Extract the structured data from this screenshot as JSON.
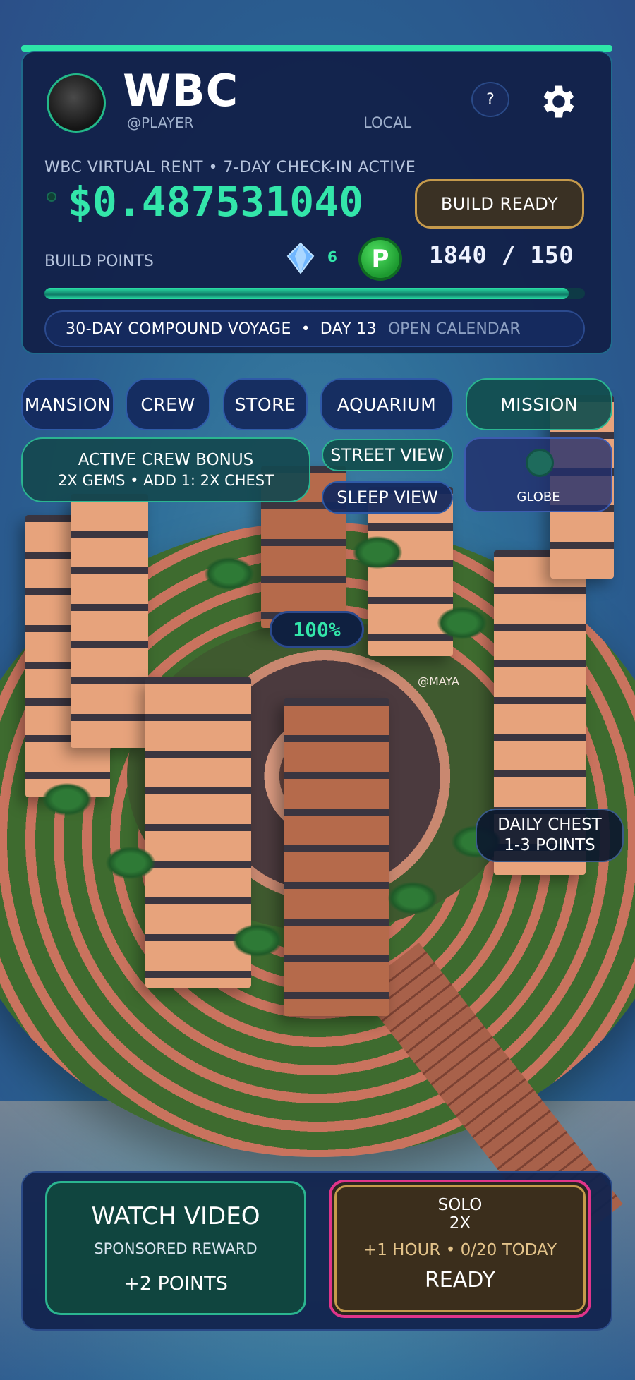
{
  "header": {
    "title": "WBC",
    "handle": "@PLAYER",
    "location": "LOCAL",
    "help_label": "?"
  },
  "rent": {
    "caption": "WBC VIRTUAL RENT  •  7-DAY CHECK-IN ACTIVE",
    "value": "$0.487531040",
    "build_button": "BUILD READY"
  },
  "build_points": {
    "label": "BUILD POINTS",
    "gems": "6",
    "coin_letter": "P",
    "value": "1840 / 150",
    "progress_fraction": 0.97
  },
  "voyage": {
    "title": "30-DAY COMPOUND VOYAGE",
    "separator": "•",
    "day": "DAY 13",
    "calendar_link": "OPEN CALENDAR"
  },
  "nav": {
    "mansion": "MANSION",
    "crew": "CREW",
    "store": "STORE",
    "aquarium": "AQUARIUM",
    "mission": "MISSION"
  },
  "crew_bonus": {
    "title": "ACTIVE CREW BONUS",
    "detail": "2X GEMS  •  ADD 1: 2X CHEST"
  },
  "views": {
    "street": "STREET VIEW",
    "sleep": "SLEEP VIEW",
    "globe": "GLOBE"
  },
  "scene": {
    "percent": "100%",
    "player_tag": "@MAYA",
    "daily_chest_line1": "DAILY CHEST",
    "daily_chest_line2": "1-3 POINTS"
  },
  "bottom": {
    "watch_title": "WATCH VIDEO",
    "watch_subtitle": "SPONSORED REWARD",
    "watch_reward": "+2 POINTS",
    "solo_line1": "SOLO",
    "solo_line2": "2X",
    "solo_line3": "+1 HOUR  •  0/20 TODAY",
    "solo_status": "READY"
  },
  "colors": {
    "accent_green": "#33e6aa",
    "panel_navy": "#122048",
    "gold_border": "#c59a4c",
    "pink_border": "#e0348a"
  },
  "icons": [
    "avatar-icon",
    "help-icon",
    "gear-icon",
    "gem-icon",
    "p-coin-icon",
    "globe-icon"
  ]
}
